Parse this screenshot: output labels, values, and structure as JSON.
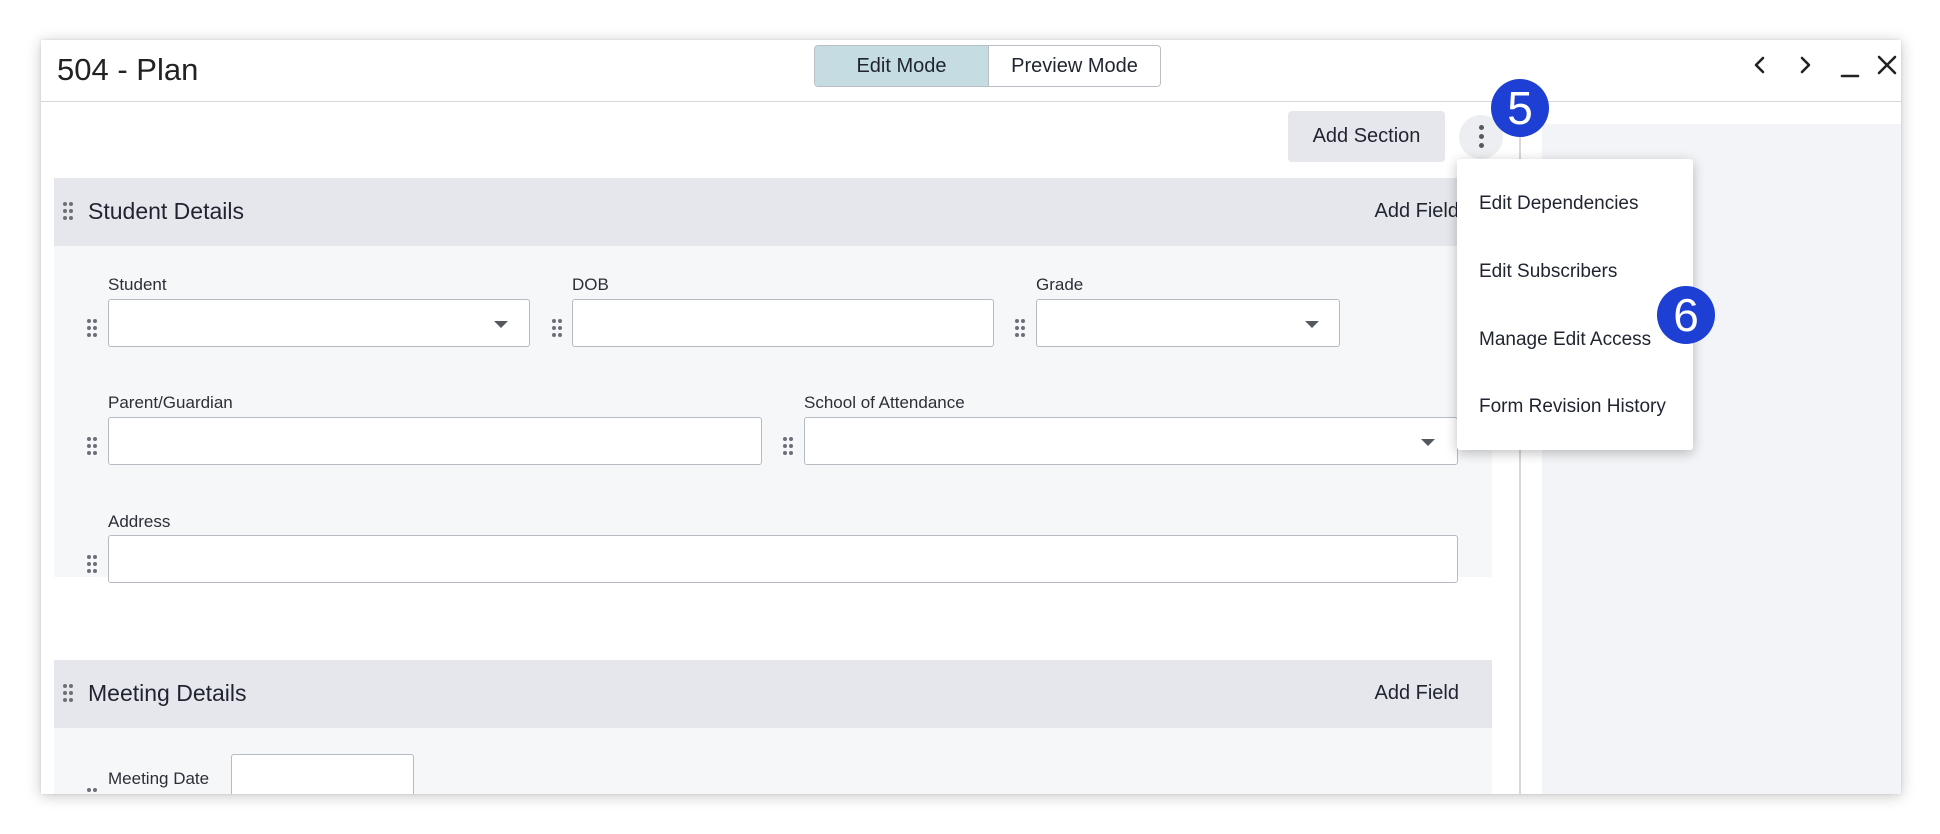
{
  "window": {
    "title": "504 - Plan",
    "modes": {
      "edit": "Edit Mode",
      "preview": "Preview Mode",
      "active": "edit"
    }
  },
  "toolbar": {
    "add_section_label": "Add Section"
  },
  "menu": {
    "items": [
      {
        "label": "Edit Dependencies"
      },
      {
        "label": "Edit Subscribers"
      },
      {
        "label": "Manage Edit Access"
      },
      {
        "label": "Form Revision History"
      }
    ]
  },
  "badges": [
    {
      "number": "5"
    },
    {
      "number": "6"
    }
  ],
  "sections": [
    {
      "title": "Student Details",
      "add_field_label": "Add Field",
      "fields": [
        {
          "label": "Student",
          "type": "select",
          "value": ""
        },
        {
          "label": "DOB",
          "type": "text",
          "value": ""
        },
        {
          "label": "Grade",
          "type": "select",
          "value": ""
        },
        {
          "label": "Parent/Guardian",
          "type": "text",
          "value": ""
        },
        {
          "label": "School of Attendance",
          "type": "select",
          "value": ""
        },
        {
          "label": "Address",
          "type": "text",
          "value": ""
        }
      ]
    },
    {
      "title": "Meeting Details",
      "add_field_label": "Add Field",
      "fields": [
        {
          "label": "Meeting Date",
          "type": "text",
          "value": ""
        }
      ]
    }
  ],
  "colors": {
    "accent_badge": "#1d3fd3",
    "active_mode": "#c5dce3",
    "section_header": "#e6e7ec",
    "section_body": "#f6f7f9"
  }
}
